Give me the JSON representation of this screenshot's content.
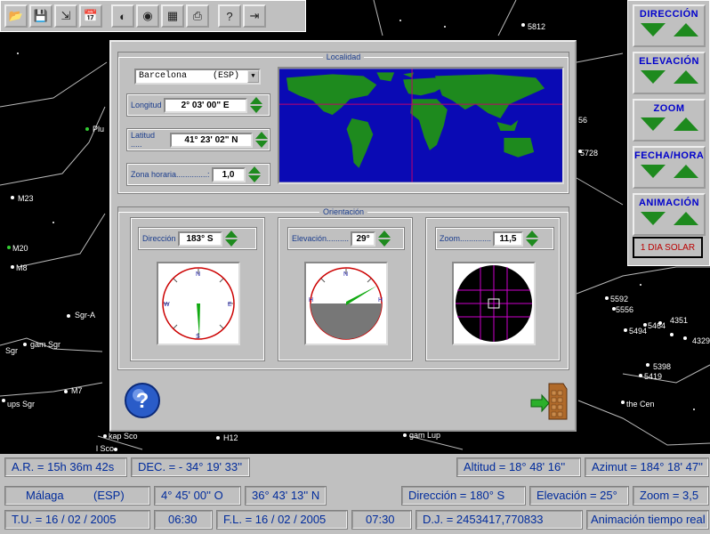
{
  "toolbar": {
    "buttons": [
      {
        "icon": "open-folder-icon",
        "glyph": "📂"
      },
      {
        "icon": "save-disk-icon",
        "glyph": "💾"
      },
      {
        "icon": "import-icon",
        "glyph": "⇲"
      },
      {
        "icon": "calendar-icon",
        "glyph": "📅"
      },
      {
        "icon": "moon-phase-icon",
        "glyph": "◐"
      },
      {
        "icon": "binoculars-icon",
        "glyph": "◉"
      },
      {
        "icon": "catalog-icon",
        "glyph": "▦"
      },
      {
        "icon": "print-icon",
        "glyph": "⎙"
      },
      {
        "icon": "help-icon",
        "glyph": "?"
      },
      {
        "icon": "exit-icon",
        "glyph": "⇥"
      }
    ]
  },
  "controls": {
    "groups": [
      "DIRECCIÓN",
      "ELEVACIÓN",
      "ZOOM",
      "FECHA/HORA",
      "ANIMACIÓN"
    ],
    "solar_button": "1 DIA SOLAR"
  },
  "sky_labels": [
    "5812",
    "Plu",
    "M23",
    "M20",
    "M8",
    "Sgr-A",
    "gam Sgr",
    "Sgr",
    "M7",
    "ups Sgr",
    "kap Sco",
    "H12",
    "gam Lup",
    "5728",
    "56",
    "5592",
    "5556",
    "5494",
    "5464",
    "4351",
    "4329",
    "5398",
    "5419",
    "the Cen",
    "l Sco"
  ],
  "dialog": {
    "location_legend": "Localidad",
    "city": "Barcelona",
    "country": "(ESP)",
    "longitude_label": "Longitud",
    "longitude_value": "2° 03' 00\" E",
    "latitude_label": "Latitud .....",
    "latitude_value": "41° 23' 02\" N",
    "timezone_label": "Zona horaria..............:",
    "timezone_value": "1,0",
    "orientation_legend": "Orientación",
    "direction_label": "Dirección",
    "direction_value": "183° S",
    "elevation_label": "Elevación..........",
    "elevation_value": "29°",
    "zoom_label": "Zoom..............",
    "zoom_value": "11,5",
    "compass_letters": {
      "n": "N",
      "s": "S",
      "e": "E",
      "w": "W"
    },
    "elevation_letters": {
      "h": "H"
    }
  },
  "status": {
    "ra": "A.R. = 15h 36m 42s",
    "dec": "DEC. = - 34° 19' 33''",
    "altitude": "Altitud = 18° 48' 16''",
    "azimuth": "Azimut = 184° 18' 47''",
    "city": "Málaga",
    "country": "(ESP)",
    "lon": "4° 45' 00'' O",
    "lat": "36° 43' 13'' N",
    "direction": "Dirección = 180° S",
    "elevation": "Elevación = 25°",
    "zoom": "Zoom = 3,5",
    "tu_date": "T.U. = 16 / 02 /  2005",
    "tu_time": "06:30",
    "fl_date": "F.L. = 16 / 02 /  2005",
    "fl_time": "07:30",
    "jd": "D.J. = 2453417,770833",
    "anim": "Animación tiempo real"
  },
  "colors": {
    "accent": "#0000cc",
    "arrow": "#1e8a1e",
    "map_sea": "#0a0ab4",
    "map_land": "#1e8a1e",
    "status_text": "#002b9c"
  }
}
